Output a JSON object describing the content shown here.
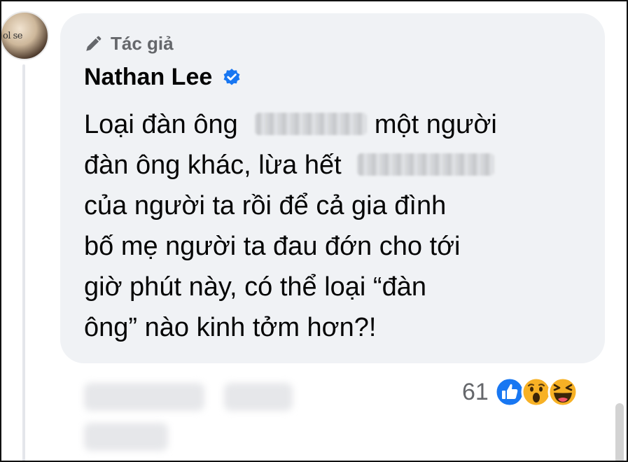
{
  "avatar": {
    "caption": "ol se"
  },
  "comment": {
    "badge_label": "Tác giả",
    "author": "Nathan Lee",
    "verified": true,
    "lines": [
      {
        "before": "Loại đàn ông",
        "after": " một người"
      },
      {
        "before": "đàn ông khác, lừa hết",
        "after": ""
      },
      {
        "text": "của người ta rồi để cả gia đình"
      },
      {
        "text": "bố mẹ người ta đau đớn cho tới"
      },
      {
        "text": "giờ phút này, có thể loại “đàn"
      },
      {
        "text": "ông” nào kinh tởm hơn?!"
      }
    ]
  },
  "reactions": {
    "count": "61",
    "types": [
      "like-icon",
      "wow-icon",
      "haha-icon"
    ]
  },
  "colors": {
    "bubble": "#f0f2f5",
    "text": "#050505",
    "secondary": "#65676b",
    "like_blue": "#1877f2",
    "reaction_yellow": "#f7b125"
  }
}
